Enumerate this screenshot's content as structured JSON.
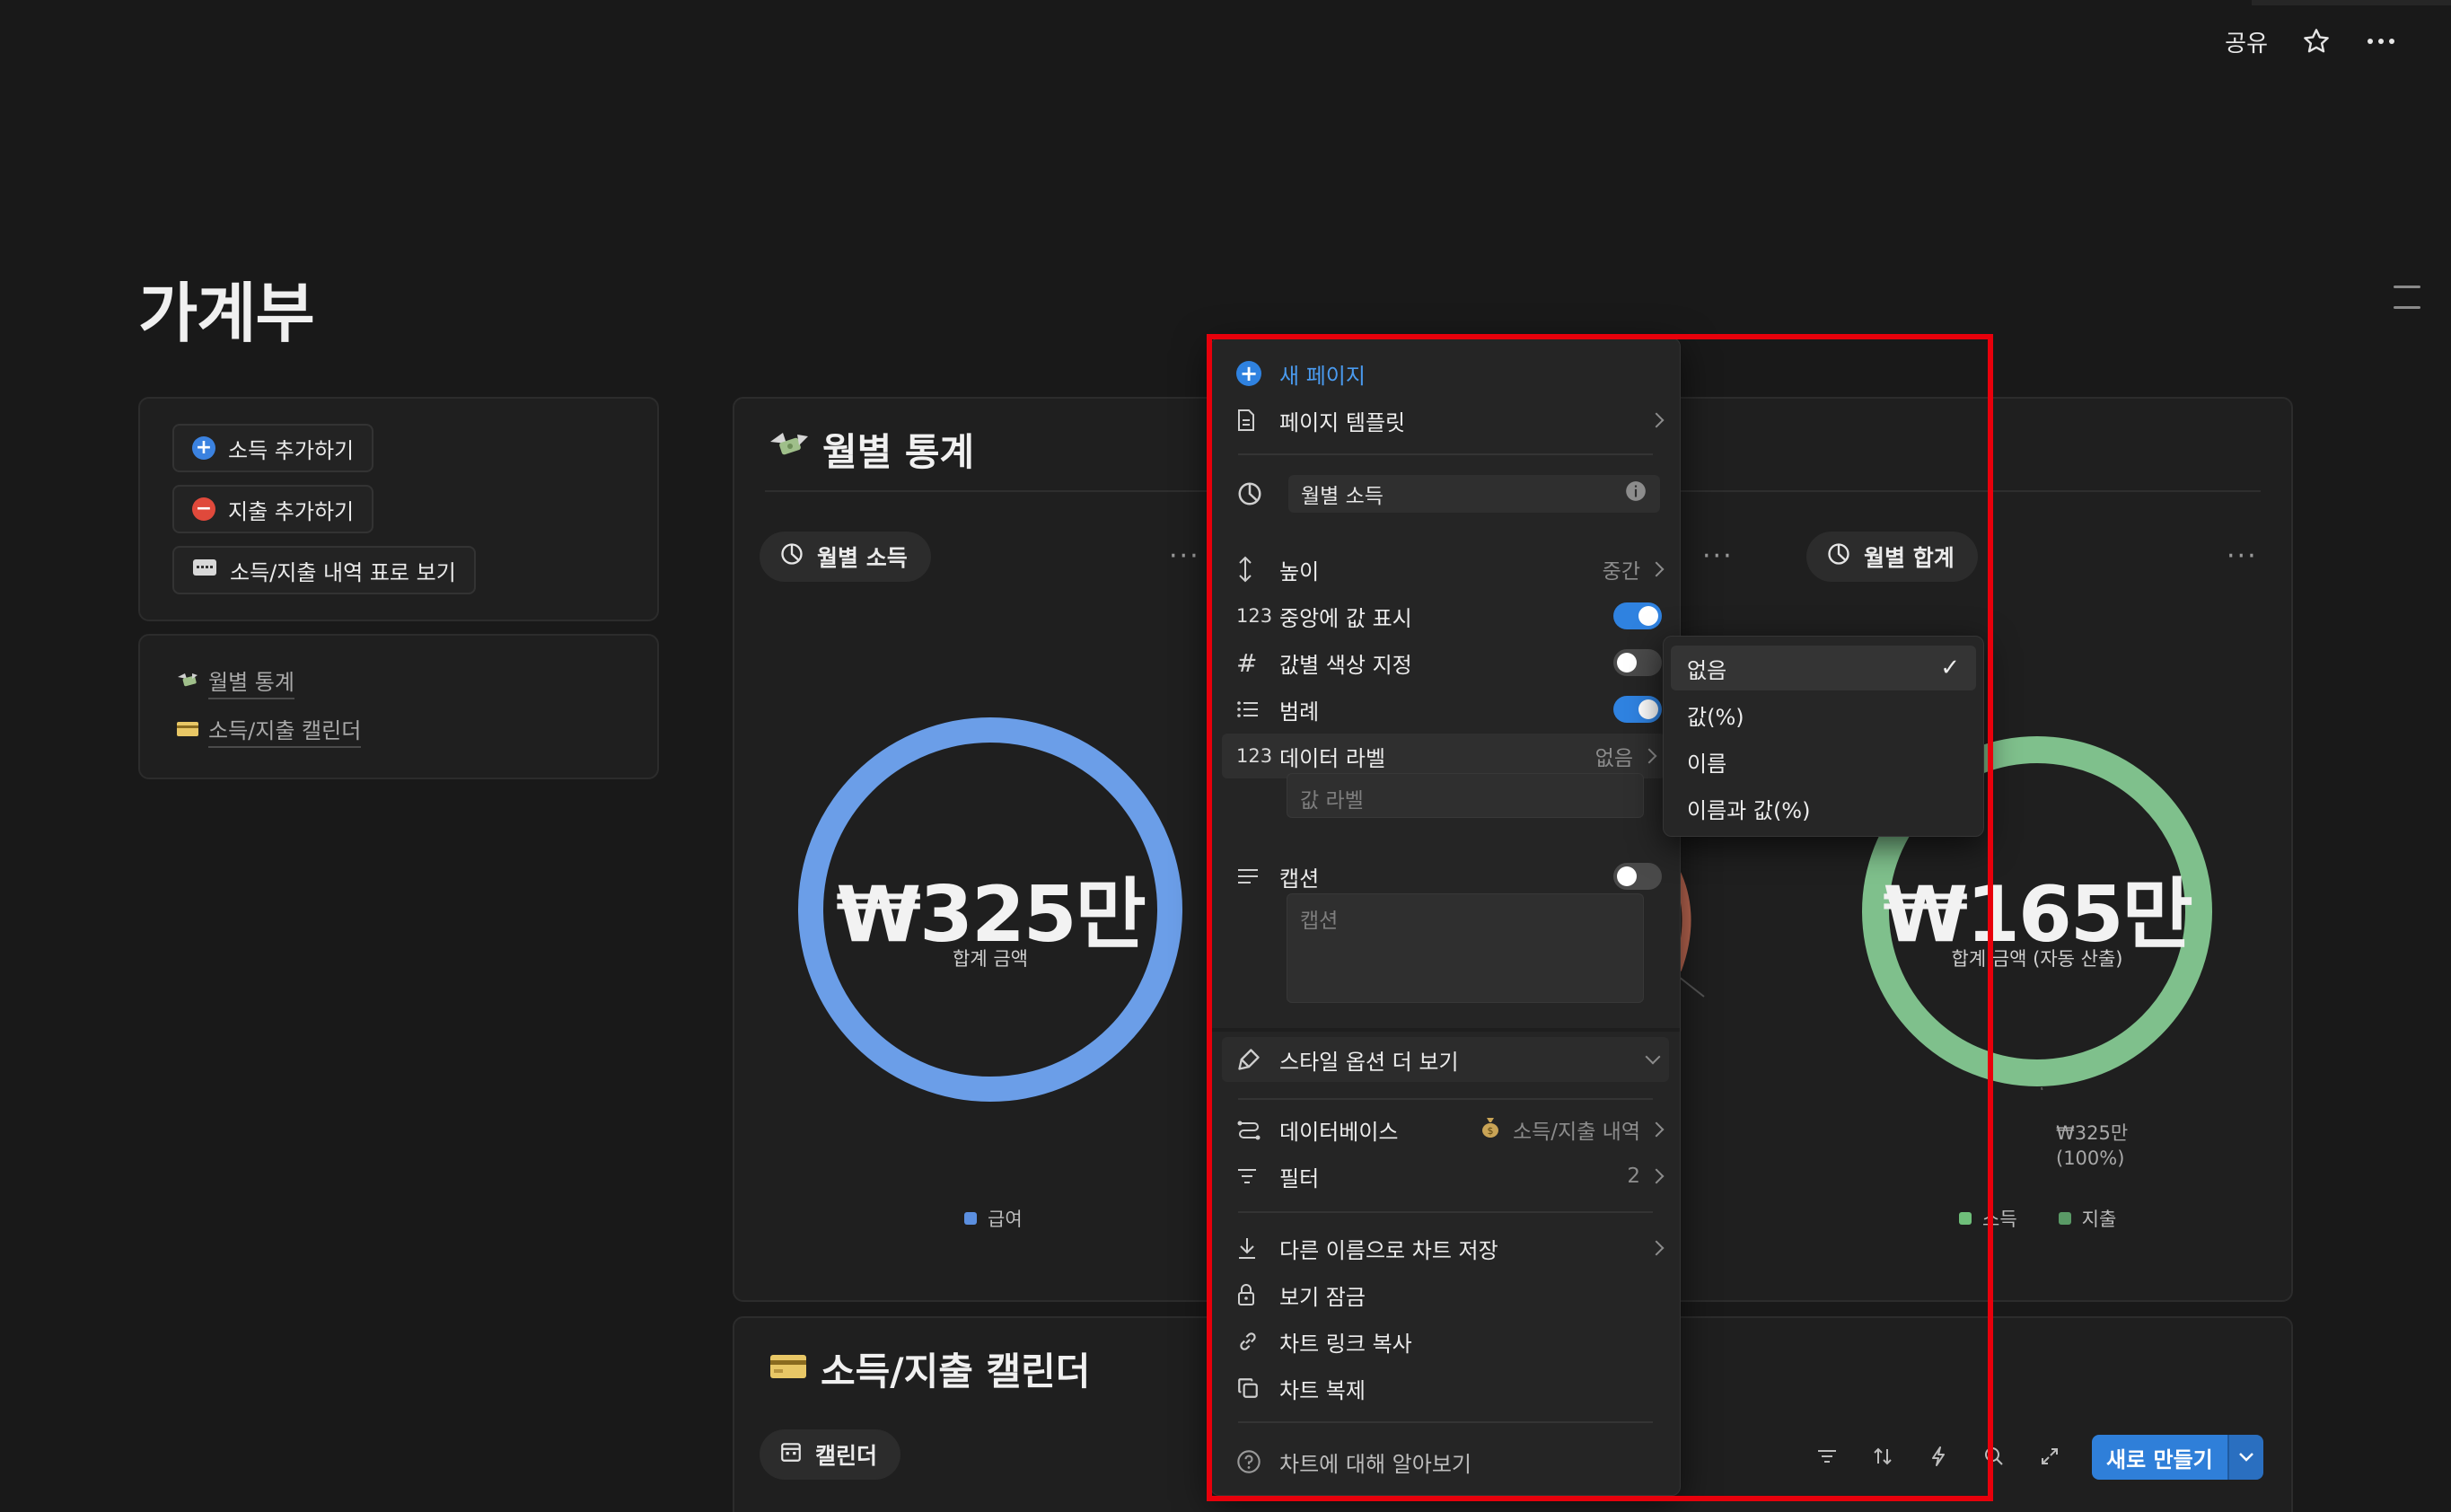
{
  "topbar": {
    "share": "공유",
    "star_icon": "star-icon",
    "more_icon": "more-icon"
  },
  "page": {
    "title": "가계부"
  },
  "quick_actions": [
    {
      "label": "소득 추가하기",
      "icon": "plus-circle-icon",
      "color": "#3b82e0"
    },
    {
      "label": "지출 추가하기",
      "icon": "minus-circle-icon",
      "color": "#e0493b"
    },
    {
      "label": "소득/지출 내역 표로 보기",
      "icon": "card-icon"
    }
  ],
  "page_links": [
    {
      "label": "월별 통계",
      "icon": "money-wings-icon"
    },
    {
      "label": "소득/지출 캘린더",
      "icon": "credit-card-icon"
    }
  ],
  "dashboard": {
    "title": "월별 통계",
    "views": [
      {
        "label": "월별 소득"
      },
      {
        "label": "월별 합계"
      }
    ],
    "charts": [
      {
        "center_value": "₩325만",
        "center_caption": "합계 금액",
        "legend": [
          {
            "name": "급여",
            "color": "#5b8fe0"
          }
        ],
        "ring_color": "#6b9ee8"
      },
      {
        "center_value": "₩165만",
        "center_caption": "합계 금액 (자동 산출)",
        "legend": [
          {
            "name": "소득",
            "color": "#6fbf7a"
          },
          {
            "name": "지출",
            "color": "#5a9a66"
          }
        ],
        "ring_color": "#7fc08c",
        "data_label": "₩325만",
        "data_label_pct": "(100%)"
      }
    ]
  },
  "calendar": {
    "title": "소득/지출 캘린더",
    "view_label": "캘린더",
    "new_button": "새로 만들기"
  },
  "menu": {
    "new_page": "새 페이지",
    "page_template": "페이지 템플릿",
    "chart_name": "월별 소득",
    "height": {
      "label": "높이",
      "value": "중간"
    },
    "center_value": {
      "label": "중앙에 값 표시",
      "on": true
    },
    "color_by_value": {
      "label": "값별 색상 지정",
      "on": false
    },
    "legend": {
      "label": "범례",
      "on": true
    },
    "data_label": {
      "label": "데이터 라벨",
      "value": "없음"
    },
    "value_label_placeholder": "값 라벨",
    "caption": {
      "label": "캡션",
      "on": false,
      "placeholder": "캡션"
    },
    "more_styles": "스타일 옵션 더 보기",
    "database": {
      "label": "데이터베이스",
      "value": "소득/지출 내역"
    },
    "filter": {
      "label": "필터",
      "value": "2"
    },
    "save_as": "다른 이름으로 차트 저장",
    "lock_view": "보기 잠금",
    "copy_link": "차트 링크 복사",
    "duplicate": "차트 복제",
    "learn": "차트에 대해 알아보기"
  },
  "submenu": {
    "options": [
      {
        "label": "없음",
        "selected": true
      },
      {
        "label": "값(%)",
        "selected": false
      },
      {
        "label": "이름",
        "selected": false
      },
      {
        "label": "이름과 값(%)",
        "selected": false
      }
    ]
  },
  "colors": {
    "highlight": "#e8000b",
    "accent": "#2f82e0"
  }
}
